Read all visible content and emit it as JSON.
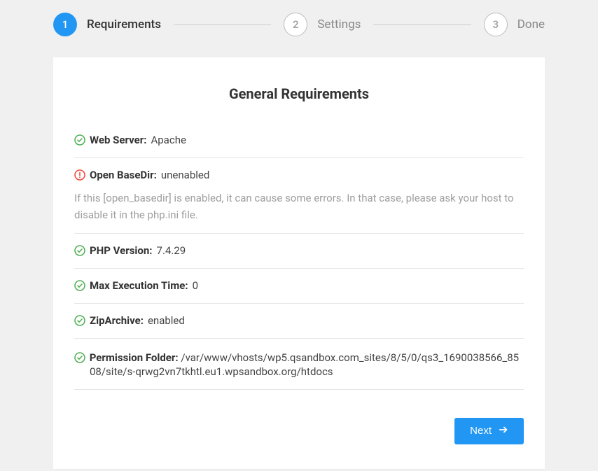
{
  "stepper": {
    "steps": [
      {
        "num": "1",
        "label": "Requirements"
      },
      {
        "num": "2",
        "label": "Settings"
      },
      {
        "num": "3",
        "label": "Done"
      }
    ]
  },
  "title": "General Requirements",
  "items": {
    "web_server": {
      "label": "Web Server",
      "value": "Apache"
    },
    "open_basedir": {
      "label": "Open BaseDir",
      "value": "unenabled",
      "note": "If this [open_basedir] is enabled, it can cause some errors. In that case, please ask your host to disable it in the php.ini file."
    },
    "php_version": {
      "label": "PHP Version",
      "value": "7.4.29"
    },
    "max_exec": {
      "label": "Max Execution Time",
      "value": "0"
    },
    "ziparchive": {
      "label": "ZipArchive",
      "value": "enabled"
    },
    "perm_folder": {
      "label": "Permission Folder",
      "value": "/var/www/vhosts/wp5.qsandbox.com_sites/8/5/0/qs3_1690038566_8508/site/s-qrwg2vn7tkhtl.eu1.wpsandbox.org/htdocs"
    }
  },
  "next_label": "Next"
}
